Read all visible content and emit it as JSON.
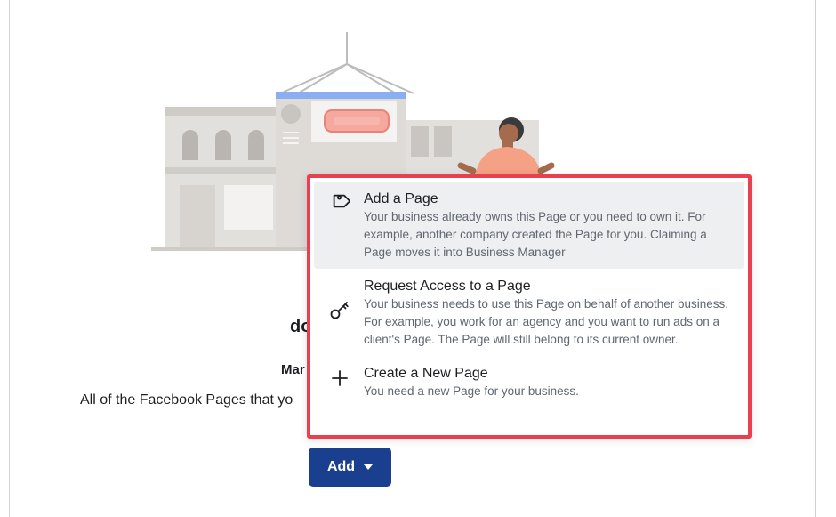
{
  "background": {
    "title_fragment": "do",
    "subtitle_fragment": "Mar",
    "description_fragment": "All of the Facebook Pages that yo"
  },
  "add_button": {
    "label": "Add"
  },
  "menu": {
    "items": [
      {
        "title": "Add a Page",
        "description": "Your business already owns this Page or you need to own it. For example, another company created the Page for you. Claiming a Page moves it into Business Manager",
        "icon": "tag-icon"
      },
      {
        "title": "Request Access to a Page",
        "description": "Your business needs to use this Page on behalf of another business. For example, you work for an agency and you want to run ads on a client's Page. The Page will still belong to its current owner.",
        "icon": "key-icon"
      },
      {
        "title": "Create a New Page",
        "description": "You need a new Page for your business.",
        "icon": "plus-icon"
      }
    ]
  },
  "colors": {
    "highlight_border": "#e8404e",
    "button_bg": "#1a3f8f",
    "hover_bg": "#eeeff1"
  }
}
